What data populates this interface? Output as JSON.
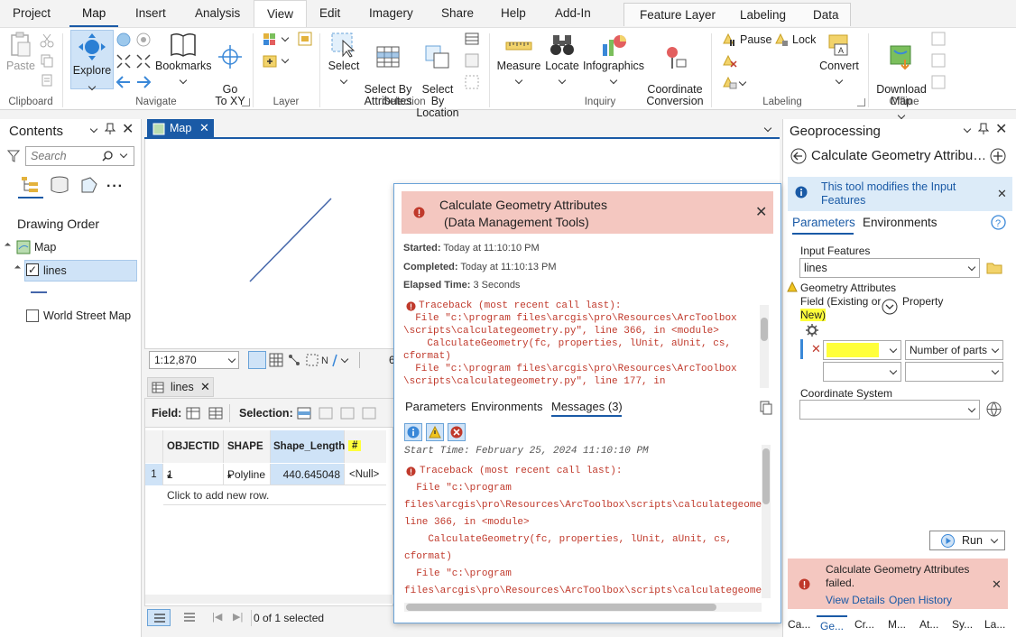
{
  "tabs": [
    "Project",
    "Map",
    "Insert",
    "Analysis",
    "View",
    "Edit",
    "Imagery",
    "Share",
    "Help",
    "Add-In"
  ],
  "context_tabs": [
    "Feature Layer",
    "Labeling",
    "Data"
  ],
  "ribbon": {
    "groups": [
      "Clipboard",
      "Navigate",
      "Layer",
      "Selection",
      "Inquiry",
      "Labeling",
      "Offline"
    ],
    "paste": "Paste",
    "explore": "Explore",
    "bookmarks": "Bookmarks",
    "goto_xy": "Go\nTo XY",
    "select": "Select",
    "select_by_attributes": "Select By\nAttributes",
    "select_by_location": "Select By\nLocation",
    "measure": "Measure",
    "locate": "Locate",
    "infographics": "Infographics",
    "coordinate_conversion": "Coordinate\nConversion",
    "pause": "Pause",
    "lock": "Lock",
    "convert": "Convert",
    "download_map": "Download\nMap"
  },
  "contents": {
    "title": "Contents",
    "search_placeholder": "Search",
    "drawing_order": "Drawing Order",
    "map_item": "Map",
    "lines_item": "lines",
    "basemap_item": "World Street Map"
  },
  "map": {
    "tab": "Map",
    "scale": "1:12,870",
    "status_partial": "6"
  },
  "table": {
    "tab": "lines",
    "field_label": "Field:",
    "selection_label": "Selection:",
    "columns": [
      "OBJECTID *",
      "SHAPE *",
      "Shape_Length",
      "#"
    ],
    "rows": [
      {
        "num": "1",
        "objectid": "1",
        "shape": "Polyline",
        "length": "440.645048",
        "hash": "<Null>"
      }
    ],
    "add_row": "Click to add new row.",
    "status": "0 of 1 selected"
  },
  "geoprocessing": {
    "title": "Geoprocessing",
    "tool_title": "Calculate Geometry Attribu…",
    "info": "This tool modifies the Input Features",
    "tab_parameters": "Parameters",
    "tab_environments": "Environments",
    "input_features_label": "Input Features",
    "input_features_value": "lines",
    "geom_attr_label": "Geometry Attributes",
    "field_label_1": "Field (Existing or",
    "field_label_2": "New)",
    "property_label": "Property",
    "field_value": "",
    "property_value": "Number of parts",
    "coord_system_label": "Coordinate System",
    "run": "Run",
    "failed_msg": "Calculate Geometry Attributes failed.",
    "view_details": "View Details",
    "open_history": "Open History",
    "bottom_tabs": [
      "Ca...",
      "Ge...",
      "Cr...",
      "M...",
      "At...",
      "Sy...",
      "La..."
    ]
  },
  "popup": {
    "title_1": "Calculate Geometry Attributes",
    "title_2": "(Data Management Tools)",
    "started_label": "Started:",
    "started_value": "Today at 11:10:10 PM",
    "completed_label": "Completed:",
    "completed_value": "Today at 11:10:13 PM",
    "elapsed_label": "Elapsed Time:",
    "elapsed_value": "3 Seconds",
    "trace_top": [
      "Traceback (most recent call last):",
      "  File \"c:\\program files\\arcgis\\pro\\Resources\\ArcToolbox",
      "\\scripts\\calculategeometry.py\", line 366, in <module>",
      "    CalculateGeometry(fc, properties, lUnit, aUnit, cs,",
      "cformat)",
      "  File \"c:\\program files\\arcgis\\pro\\Resources\\ArcToolbox",
      "\\scripts\\calculategeometry.py\", line 177, in"
    ],
    "tab_parameters": "Parameters",
    "tab_environments": "Environments",
    "tab_messages": "Messages (3)",
    "start_time": "Start Time: February 25, 2024 11:10:10 PM",
    "trace_bottom": [
      "Traceback (most recent call last):",
      "  File \"c:\\program",
      "files\\arcgis\\pro\\Resources\\ArcToolbox\\scripts\\calculategeome",
      "line 366, in <module>",
      "    CalculateGeometry(fc, properties, lUnit, aUnit, cs,",
      "cformat)",
      "  File \"c:\\program",
      "files\\arcgis\\pro\\Resources\\ArcToolbox\\scripts\\calculategeome"
    ]
  },
  "colors": {
    "accent": "#1a5aa6",
    "error_header": "#f4c7c0",
    "error_text": "#c0392b",
    "highlight": "#ffff3a",
    "info_bg": "#dcebf8"
  }
}
